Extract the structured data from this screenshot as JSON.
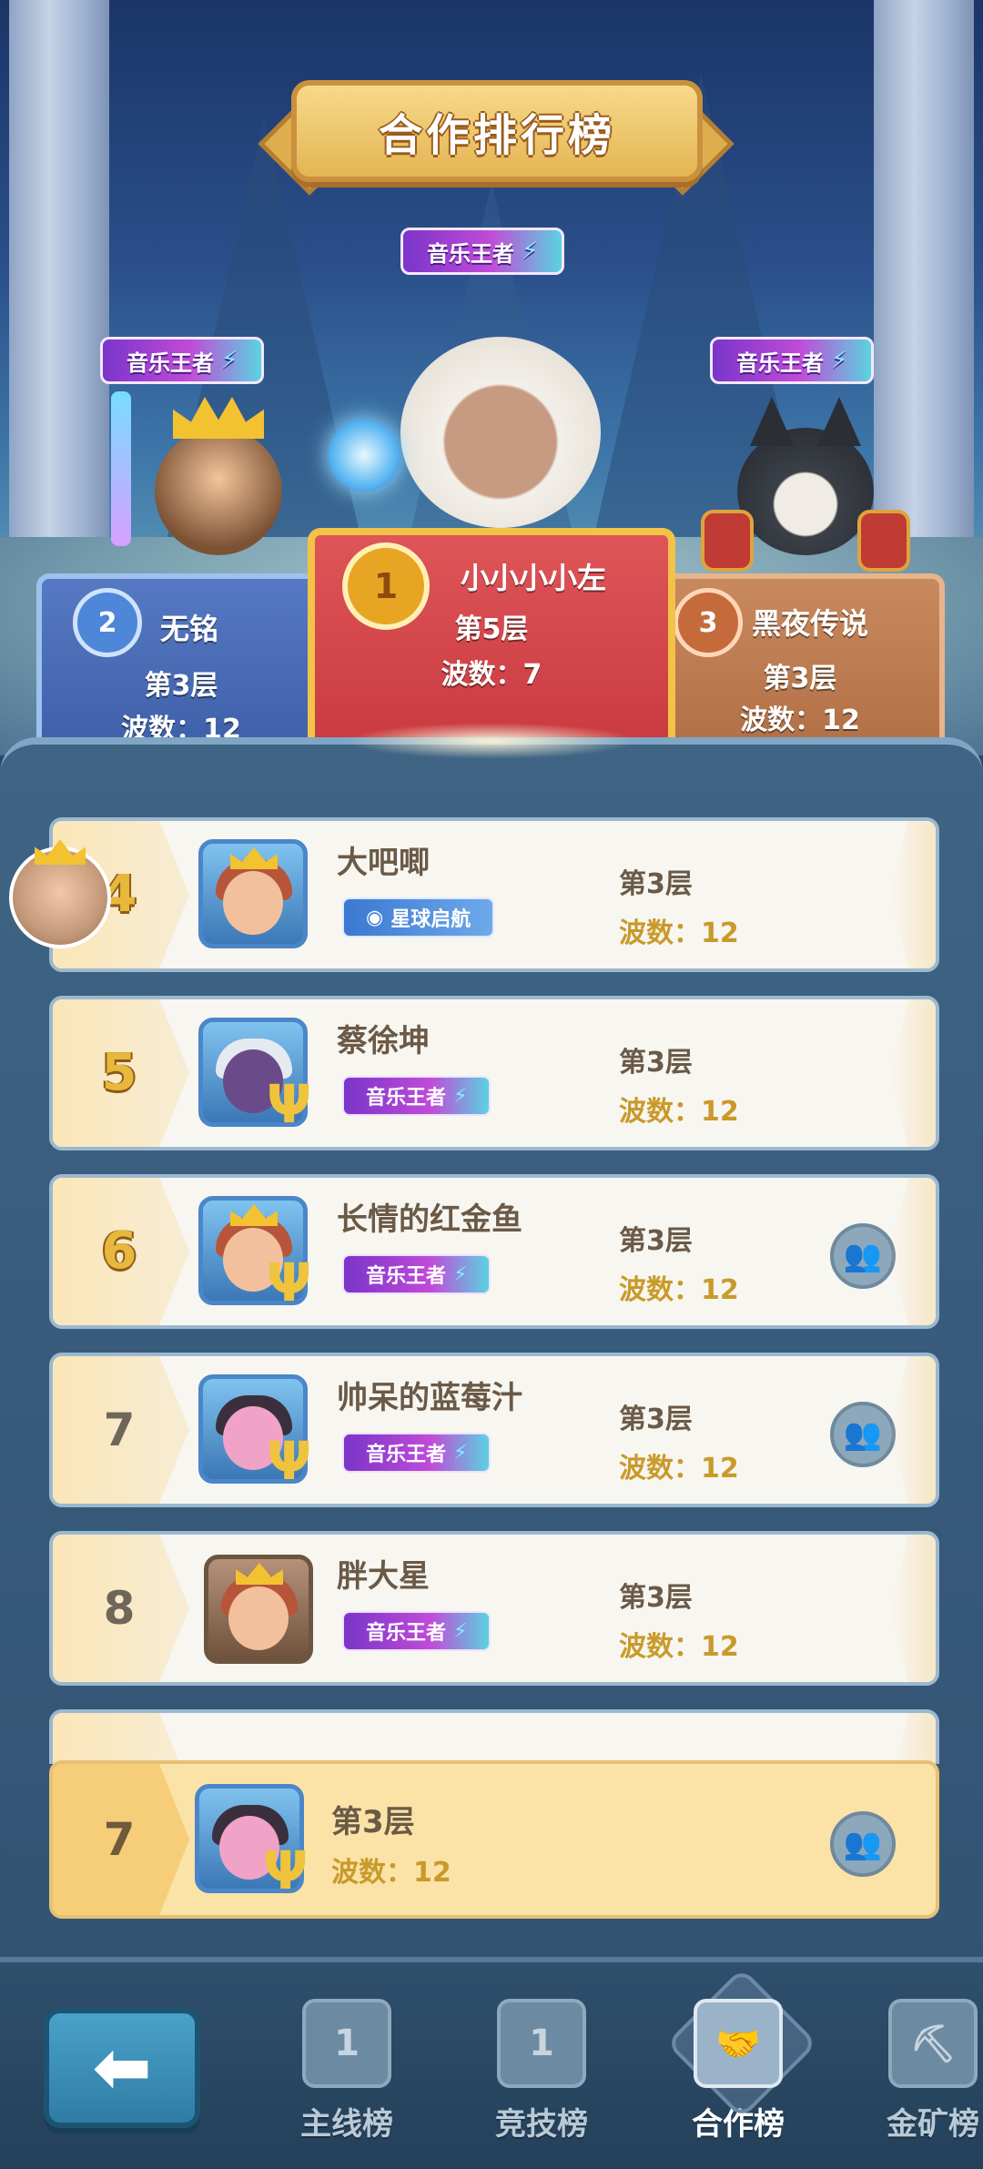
{
  "title": "合作排行榜",
  "top3": [
    {
      "rank": "2",
      "name": "无铭",
      "floor": "第3层",
      "waves": "波数：12",
      "tag": "音乐王者"
    },
    {
      "rank": "1",
      "name": "小小小小左",
      "floor": "第5层",
      "waves": "波数：7",
      "tag": "音乐王者"
    },
    {
      "rank": "3",
      "name": "黑夜传说",
      "floor": "第3层",
      "waves": "波数：12",
      "tag": "音乐王者"
    }
  ],
  "list": [
    {
      "rank": "4",
      "name": "大吧唧",
      "tag": "星球启航",
      "floor": "第3层",
      "waves": "波数：12"
    },
    {
      "rank": "5",
      "name": "蔡徐坤",
      "tag": "音乐王者",
      "floor": "第3层",
      "waves": "波数：12"
    },
    {
      "rank": "6",
      "name": "长情的红金鱼",
      "tag": "音乐王者",
      "floor": "第3层",
      "waves": "波数：12"
    },
    {
      "rank": "7",
      "name": "帅呆的蓝莓汁",
      "tag": "音乐王者",
      "floor": "第3层",
      "waves": "波数：12"
    },
    {
      "rank": "8",
      "name": "胖大星",
      "tag": "音乐王者",
      "floor": "第3层",
      "waves": "波数：12"
    }
  ],
  "my_row": {
    "rank": "7",
    "floor": "第3层",
    "waves": "波数：12"
  },
  "nav": {
    "back_icon": "arrow-left-icon",
    "items": [
      {
        "label": "主线榜",
        "icon": "cart-1-icon",
        "glyph": "1"
      },
      {
        "label": "竞技榜",
        "icon": "banner-1-icon",
        "glyph": "1"
      },
      {
        "label": "合作榜",
        "icon": "handshake-icon",
        "glyph": "🤝"
      },
      {
        "label": "金矿榜",
        "icon": "mine-cart-icon",
        "glyph": "⛏"
      }
    ],
    "active": "合作榜"
  },
  "colors": {
    "accent_gold": "#e7b83b",
    "tag_purple": "#c04bd8",
    "panel": "#3f6484"
  }
}
